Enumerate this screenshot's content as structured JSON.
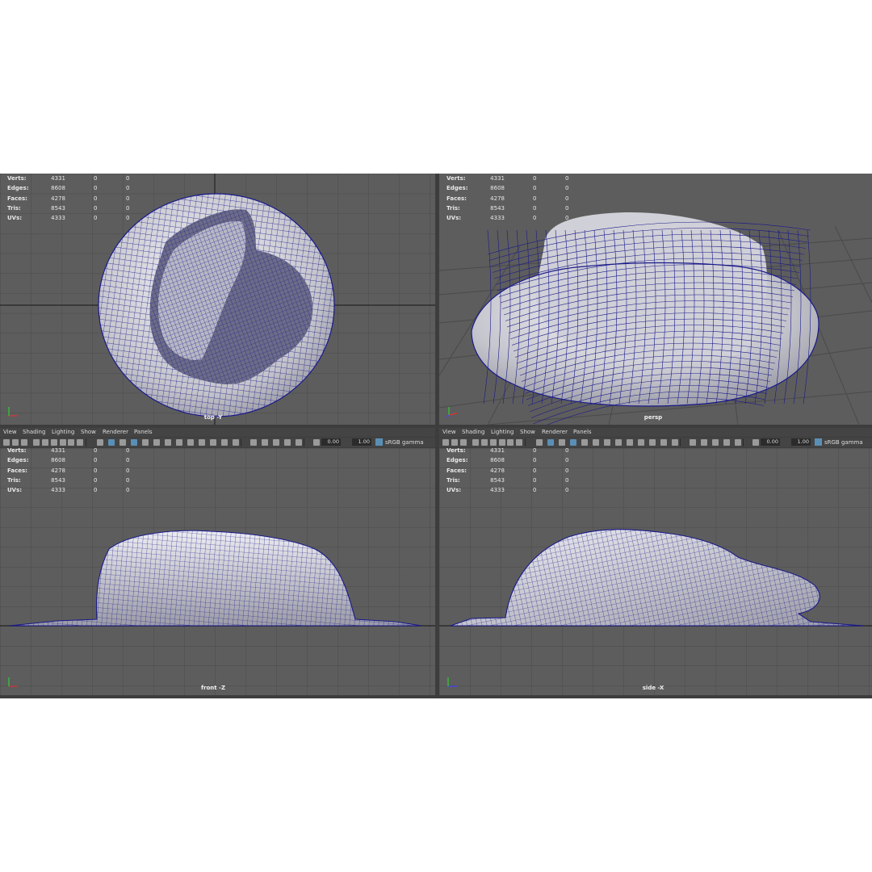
{
  "stats": {
    "labels": [
      "Verts:",
      "Edges:",
      "Faces:",
      "Tris:",
      "UVs:"
    ],
    "values": [
      "4331",
      "8608",
      "4278",
      "8543",
      "4333"
    ],
    "zeros": "0"
  },
  "panels": {
    "top": {
      "camera": "top -Y"
    },
    "persp": {
      "camera": "persp"
    },
    "front": {
      "camera": "front -Z"
    },
    "side": {
      "camera": "side -X"
    }
  },
  "menu": [
    "View",
    "Shading",
    "Lighting",
    "Show",
    "Renderer",
    "Panels"
  ],
  "toolbar": {
    "exposure": "0.00",
    "gamma": "1.00",
    "color_space": "sRGB gamma"
  },
  "colors": {
    "viewport_bg": "#5d5d5d",
    "grid": "#4a4a4a",
    "wire": "#1a1a8a",
    "mesh": "#c4c4cc",
    "highlight": "#5a8fb5"
  }
}
